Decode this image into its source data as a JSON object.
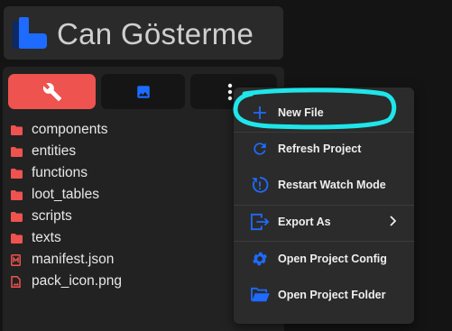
{
  "header": {
    "project_name": "Can Gösterme",
    "logo_icon": "bridge-logo-icon",
    "accent": "#1e6bff"
  },
  "tabs": [
    {
      "icon": "wrench-icon",
      "active": true,
      "color": "#ee5350"
    },
    {
      "icon": "image-icon",
      "active": false
    },
    {
      "icon": "more-vertical-icon",
      "active": false
    }
  ],
  "files": [
    {
      "name": "components",
      "type": "folder"
    },
    {
      "name": "entities",
      "type": "folder"
    },
    {
      "name": "functions",
      "type": "folder"
    },
    {
      "name": "loot_tables",
      "type": "folder"
    },
    {
      "name": "scripts",
      "type": "folder"
    },
    {
      "name": "texts",
      "type": "folder"
    },
    {
      "name": "manifest.json",
      "type": "json-file"
    },
    {
      "name": "pack_icon.png",
      "type": "image-file"
    }
  ],
  "menu": {
    "items": [
      {
        "label": "New File",
        "icon": "plus-icon"
      },
      {
        "label": "Refresh Project",
        "icon": "refresh-icon"
      },
      {
        "label": "Restart Watch Mode",
        "icon": "restart-alert-icon"
      },
      {
        "label": "Export As",
        "icon": "export-icon",
        "submenu": true
      },
      {
        "label": "Open Project Config",
        "icon": "gear-icon"
      },
      {
        "label": "Open Project Folder",
        "icon": "folder-open-icon"
      }
    ],
    "icon_color": "#1e6bff",
    "highlight_color": "#1ee6ea"
  }
}
